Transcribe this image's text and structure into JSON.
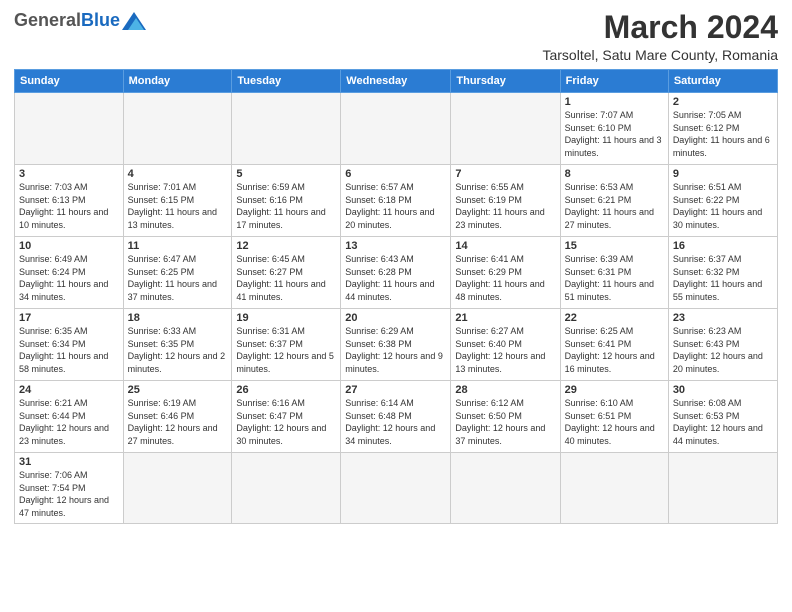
{
  "header": {
    "logo_general": "General",
    "logo_blue": "Blue",
    "month_year": "March 2024",
    "location": "Tarsoltel, Satu Mare County, Romania"
  },
  "days_of_week": [
    "Sunday",
    "Monday",
    "Tuesday",
    "Wednesday",
    "Thursday",
    "Friday",
    "Saturday"
  ],
  "weeks": [
    [
      {
        "day": "",
        "info": ""
      },
      {
        "day": "",
        "info": ""
      },
      {
        "day": "",
        "info": ""
      },
      {
        "day": "",
        "info": ""
      },
      {
        "day": "",
        "info": ""
      },
      {
        "day": "1",
        "info": "Sunrise: 7:07 AM\nSunset: 6:10 PM\nDaylight: 11 hours and 3 minutes."
      },
      {
        "day": "2",
        "info": "Sunrise: 7:05 AM\nSunset: 6:12 PM\nDaylight: 11 hours and 6 minutes."
      }
    ],
    [
      {
        "day": "3",
        "info": "Sunrise: 7:03 AM\nSunset: 6:13 PM\nDaylight: 11 hours and 10 minutes."
      },
      {
        "day": "4",
        "info": "Sunrise: 7:01 AM\nSunset: 6:15 PM\nDaylight: 11 hours and 13 minutes."
      },
      {
        "day": "5",
        "info": "Sunrise: 6:59 AM\nSunset: 6:16 PM\nDaylight: 11 hours and 17 minutes."
      },
      {
        "day": "6",
        "info": "Sunrise: 6:57 AM\nSunset: 6:18 PM\nDaylight: 11 hours and 20 minutes."
      },
      {
        "day": "7",
        "info": "Sunrise: 6:55 AM\nSunset: 6:19 PM\nDaylight: 11 hours and 23 minutes."
      },
      {
        "day": "8",
        "info": "Sunrise: 6:53 AM\nSunset: 6:21 PM\nDaylight: 11 hours and 27 minutes."
      },
      {
        "day": "9",
        "info": "Sunrise: 6:51 AM\nSunset: 6:22 PM\nDaylight: 11 hours and 30 minutes."
      }
    ],
    [
      {
        "day": "10",
        "info": "Sunrise: 6:49 AM\nSunset: 6:24 PM\nDaylight: 11 hours and 34 minutes."
      },
      {
        "day": "11",
        "info": "Sunrise: 6:47 AM\nSunset: 6:25 PM\nDaylight: 11 hours and 37 minutes."
      },
      {
        "day": "12",
        "info": "Sunrise: 6:45 AM\nSunset: 6:27 PM\nDaylight: 11 hours and 41 minutes."
      },
      {
        "day": "13",
        "info": "Sunrise: 6:43 AM\nSunset: 6:28 PM\nDaylight: 11 hours and 44 minutes."
      },
      {
        "day": "14",
        "info": "Sunrise: 6:41 AM\nSunset: 6:29 PM\nDaylight: 11 hours and 48 minutes."
      },
      {
        "day": "15",
        "info": "Sunrise: 6:39 AM\nSunset: 6:31 PM\nDaylight: 11 hours and 51 minutes."
      },
      {
        "day": "16",
        "info": "Sunrise: 6:37 AM\nSunset: 6:32 PM\nDaylight: 11 hours and 55 minutes."
      }
    ],
    [
      {
        "day": "17",
        "info": "Sunrise: 6:35 AM\nSunset: 6:34 PM\nDaylight: 11 hours and 58 minutes."
      },
      {
        "day": "18",
        "info": "Sunrise: 6:33 AM\nSunset: 6:35 PM\nDaylight: 12 hours and 2 minutes."
      },
      {
        "day": "19",
        "info": "Sunrise: 6:31 AM\nSunset: 6:37 PM\nDaylight: 12 hours and 5 minutes."
      },
      {
        "day": "20",
        "info": "Sunrise: 6:29 AM\nSunset: 6:38 PM\nDaylight: 12 hours and 9 minutes."
      },
      {
        "day": "21",
        "info": "Sunrise: 6:27 AM\nSunset: 6:40 PM\nDaylight: 12 hours and 13 minutes."
      },
      {
        "day": "22",
        "info": "Sunrise: 6:25 AM\nSunset: 6:41 PM\nDaylight: 12 hours and 16 minutes."
      },
      {
        "day": "23",
        "info": "Sunrise: 6:23 AM\nSunset: 6:43 PM\nDaylight: 12 hours and 20 minutes."
      }
    ],
    [
      {
        "day": "24",
        "info": "Sunrise: 6:21 AM\nSunset: 6:44 PM\nDaylight: 12 hours and 23 minutes."
      },
      {
        "day": "25",
        "info": "Sunrise: 6:19 AM\nSunset: 6:46 PM\nDaylight: 12 hours and 27 minutes."
      },
      {
        "day": "26",
        "info": "Sunrise: 6:16 AM\nSunset: 6:47 PM\nDaylight: 12 hours and 30 minutes."
      },
      {
        "day": "27",
        "info": "Sunrise: 6:14 AM\nSunset: 6:48 PM\nDaylight: 12 hours and 34 minutes."
      },
      {
        "day": "28",
        "info": "Sunrise: 6:12 AM\nSunset: 6:50 PM\nDaylight: 12 hours and 37 minutes."
      },
      {
        "day": "29",
        "info": "Sunrise: 6:10 AM\nSunset: 6:51 PM\nDaylight: 12 hours and 40 minutes."
      },
      {
        "day": "30",
        "info": "Sunrise: 6:08 AM\nSunset: 6:53 PM\nDaylight: 12 hours and 44 minutes."
      }
    ],
    [
      {
        "day": "31",
        "info": "Sunrise: 7:06 AM\nSunset: 7:54 PM\nDaylight: 12 hours and 47 minutes."
      },
      {
        "day": "",
        "info": ""
      },
      {
        "day": "",
        "info": ""
      },
      {
        "day": "",
        "info": ""
      },
      {
        "day": "",
        "info": ""
      },
      {
        "day": "",
        "info": ""
      },
      {
        "day": "",
        "info": ""
      }
    ]
  ]
}
